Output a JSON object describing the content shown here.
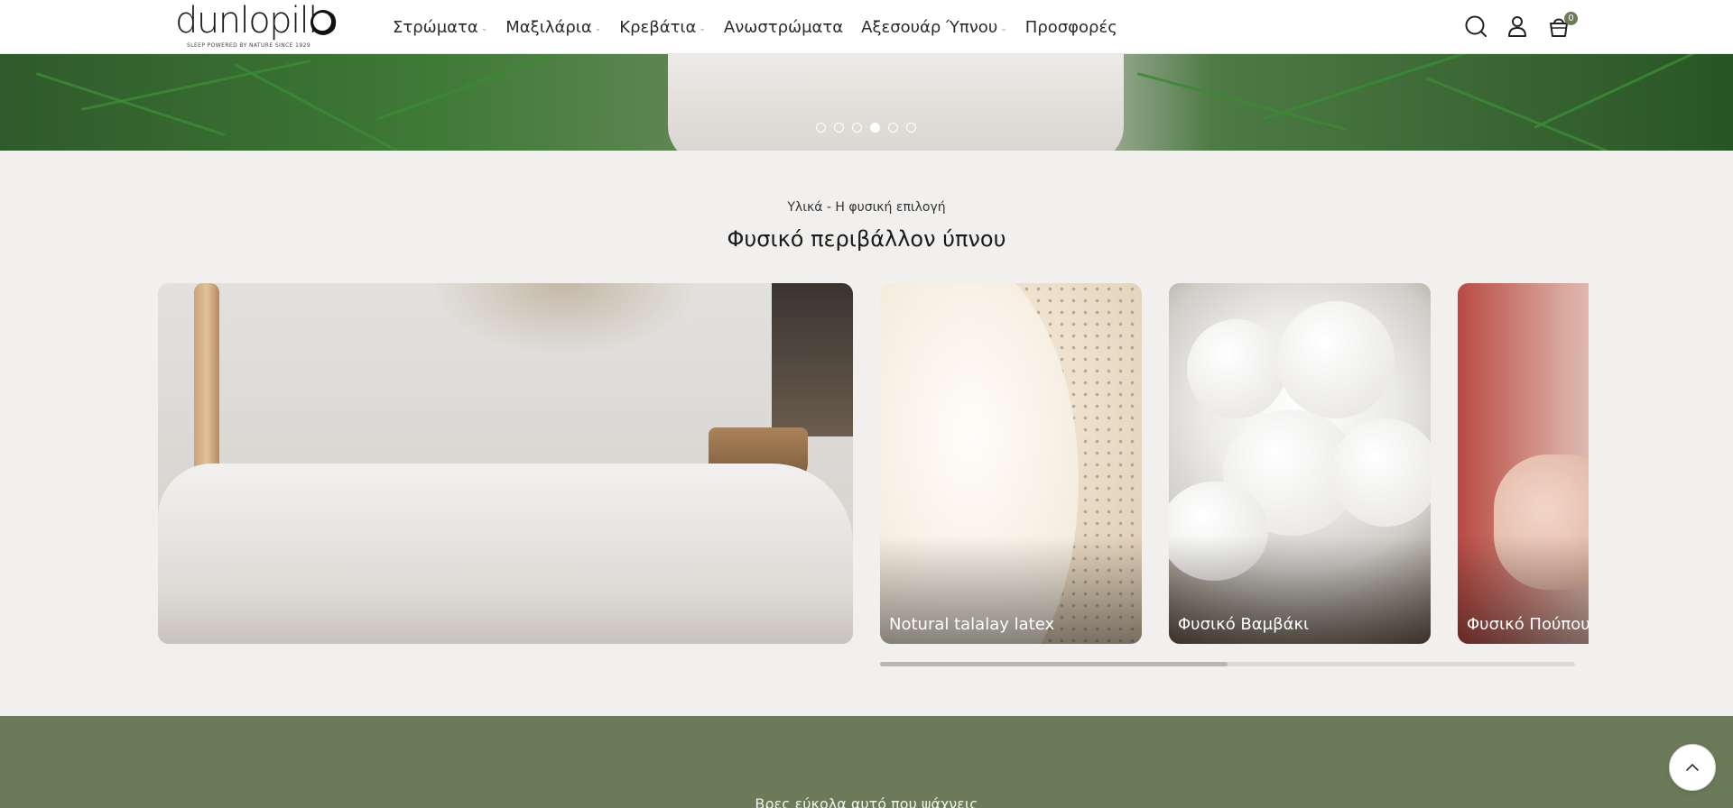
{
  "brand": {
    "name": "dunlopillo",
    "tagline": "SLEEP POWERED BY NATURE SINCE 1929"
  },
  "nav": {
    "items": [
      {
        "label": "Στρώματα",
        "has_dropdown": true
      },
      {
        "label": "Μαξιλάρια",
        "has_dropdown": true
      },
      {
        "label": "Κρεβάτια",
        "has_dropdown": true
      },
      {
        "label": "Ανωστρώματα",
        "has_dropdown": false
      },
      {
        "label": "Αξεσουάρ Ύπνου",
        "has_dropdown": true
      },
      {
        "label": "Προσφορές",
        "has_dropdown": false
      }
    ],
    "dropdown_icon": "chevron-down-icon"
  },
  "header_icons": {
    "search": "search-icon",
    "account": "user-icon",
    "cart": "cart-icon",
    "cart_count": "0"
  },
  "hero": {
    "slides_total": 6,
    "active_slide": 4
  },
  "section": {
    "eyebrow": "Υλικά - Η φυσική επιλογή",
    "title": "Φυσικό περιβάλλον ύπνου",
    "cards": [
      {
        "label": "Notural talalay latex"
      },
      {
        "label": "Φυσικό Βαμβάκι"
      },
      {
        "label": "Φυσικό Πούπουλο"
      }
    ],
    "scroll_progress": 0.5
  },
  "footer_band": {
    "text": "Βρες εύκολα αυτό που ψάχνεις"
  },
  "colors": {
    "accent_green": "#6b7b5a",
    "background": "#f2f0ee",
    "header_bg": "#ffffff"
  },
  "back_to_top_icon": "chevron-up-icon"
}
